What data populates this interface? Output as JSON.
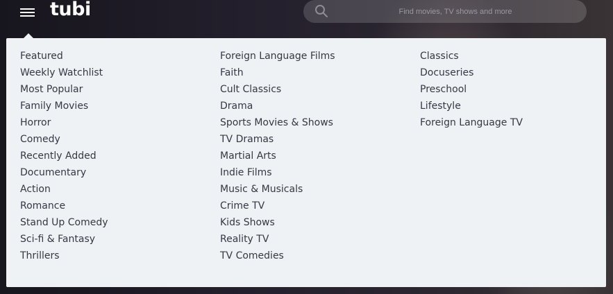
{
  "header": {
    "logo_text": "tubi",
    "search_placeholder": "Find movies, TV shows and more"
  },
  "menu": {
    "columns": [
      [
        "Featured",
        "Weekly Watchlist",
        "Most Popular",
        "Family Movies",
        "Horror",
        "Comedy",
        "Recently Added",
        "Documentary",
        "Action",
        "Romance",
        "Stand Up Comedy",
        "Sci-fi & Fantasy",
        "Thrillers"
      ],
      [
        "Foreign Language Films",
        "Faith",
        "Cult Classics",
        "Drama",
        "Sports Movies & Shows",
        "TV Dramas",
        "Martial Arts",
        "Indie Films",
        "Music & Musicals",
        "Crime TV",
        "Kids Shows",
        "Reality TV",
        "TV Comedies"
      ],
      [
        "Classics",
        "Docuseries",
        "Preschool",
        "Lifestyle",
        "Foreign Language TV"
      ]
    ]
  },
  "icons": {
    "menu": "hamburger-menu-icon",
    "search": "search-icon"
  },
  "colors": {
    "menu_background": "#eff2f5",
    "menu_text": "#333843",
    "header_text": "#ffffff"
  }
}
